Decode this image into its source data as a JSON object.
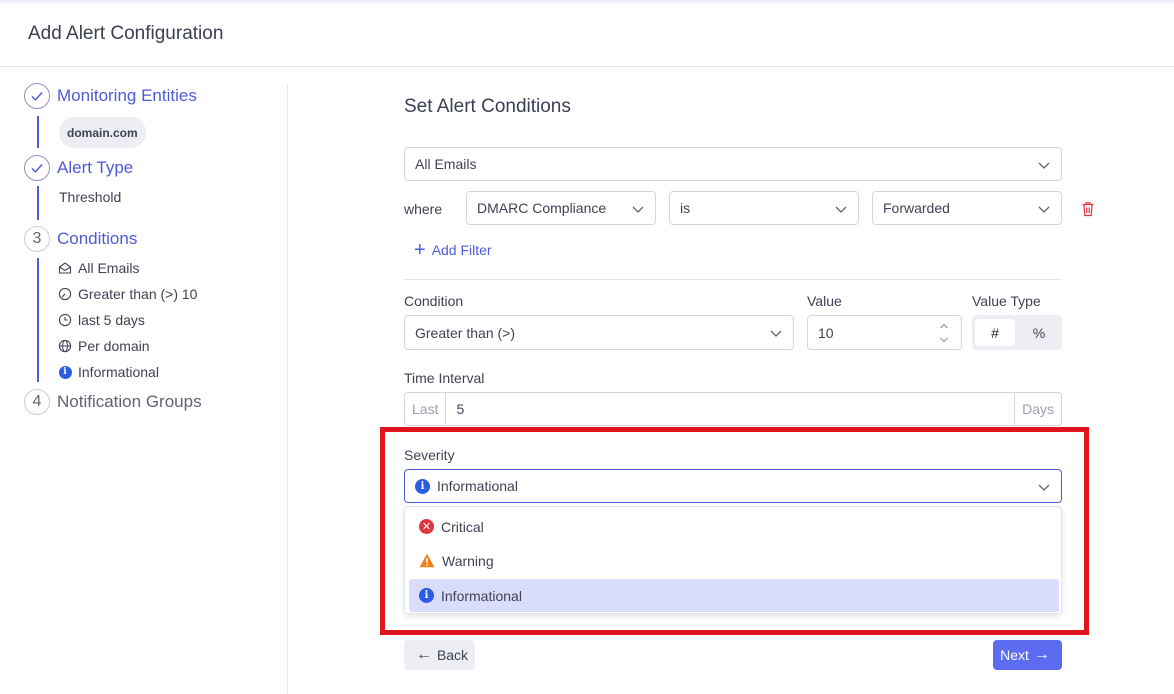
{
  "page_title": "Add Alert Configuration",
  "stepper": {
    "steps": [
      {
        "number": "",
        "label": "Monitoring Entities",
        "status": "done"
      },
      {
        "number": "",
        "label": "Alert Type",
        "status": "done"
      },
      {
        "number": "3",
        "label": "Conditions",
        "status": "active"
      },
      {
        "number": "4",
        "label": "Notification Groups",
        "status": "pending"
      }
    ],
    "domain_chip": "domain.com",
    "alert_type_value": "Threshold",
    "condition_summary": [
      {
        "icon": "envelope-icon",
        "text": "All Emails"
      },
      {
        "icon": "gauge-icon",
        "text": "Greater than (>) 10"
      },
      {
        "icon": "clock-icon",
        "text": "last 5 days"
      },
      {
        "icon": "globe-icon",
        "text": "Per domain"
      },
      {
        "icon": "info-icon",
        "text": "Informational"
      }
    ]
  },
  "form": {
    "section_title": "Set Alert Conditions",
    "scope_select": "All Emails",
    "filter": {
      "where_label": "where",
      "field": "DMARC Compliance",
      "operator": "is",
      "value": "Forwarded"
    },
    "add_filter_label": "Add Filter",
    "condition": {
      "label": "Condition",
      "value": "Greater than (>)"
    },
    "value_field": {
      "label": "Value",
      "value": "10"
    },
    "value_type": {
      "label": "Value Type",
      "options": [
        "#",
        "%"
      ],
      "selected": "#"
    },
    "time_interval": {
      "label": "Time Interval",
      "prefix": "Last",
      "value": "5",
      "suffix": "Days"
    },
    "severity": {
      "label": "Severity",
      "selected": "Informational",
      "options": [
        {
          "label": "Critical",
          "icon": "critical-icon"
        },
        {
          "label": "Warning",
          "icon": "warning-icon"
        },
        {
          "label": "Informational",
          "icon": "info-icon"
        }
      ]
    }
  },
  "buttons": {
    "back": "Back",
    "next": "Next"
  },
  "colors": {
    "accent": "#4e5bd6",
    "next_button": "#5b6cf0",
    "highlight_box": "#e0141b",
    "critical": "#e0353f",
    "warning": "#f07d1a",
    "info": "#2b5ce6",
    "selected_option_bg": "#d9dcfb"
  }
}
